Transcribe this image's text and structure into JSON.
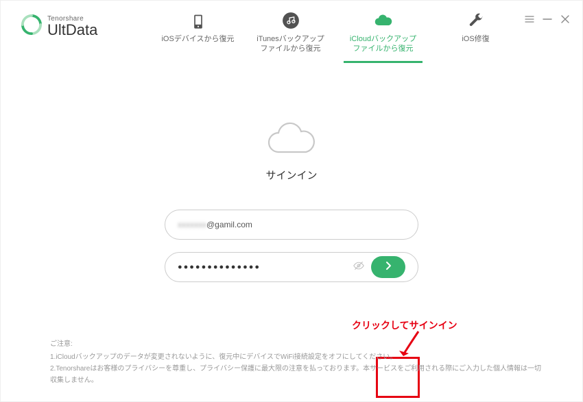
{
  "brand": {
    "vendor": "Tenorshare",
    "product": "UltData"
  },
  "tabs": [
    {
      "label": "iOSデバイスから復元",
      "active": false
    },
    {
      "label": "iTunesバックアップ\nファイルから復元",
      "active": false
    },
    {
      "label": "iCloudバックアップ\nファイルから復元",
      "active": true
    },
    {
      "label": "iOS修復",
      "active": false
    }
  ],
  "signin": {
    "title": "サインイン",
    "email_masked_prefix": "xxxxxxx",
    "email_domain": "@gamil.com",
    "password_dots": "●●●●●●●●●●●●●●"
  },
  "callout": {
    "text": "クリックしてサインイン"
  },
  "footer": {
    "heading": "ご注意:",
    "line1": "1.iCloudバックアップのデータが変更されないように、復元中にデバイスでWiFi接続設定をオフにしてください。",
    "line2": "2.Tenorshareはお客様のプライバシーを尊重し、プライバシー保護に最大限の注意を払っております。本サービスをご利用される際にご入力した個人情報は一切収集しません。"
  }
}
